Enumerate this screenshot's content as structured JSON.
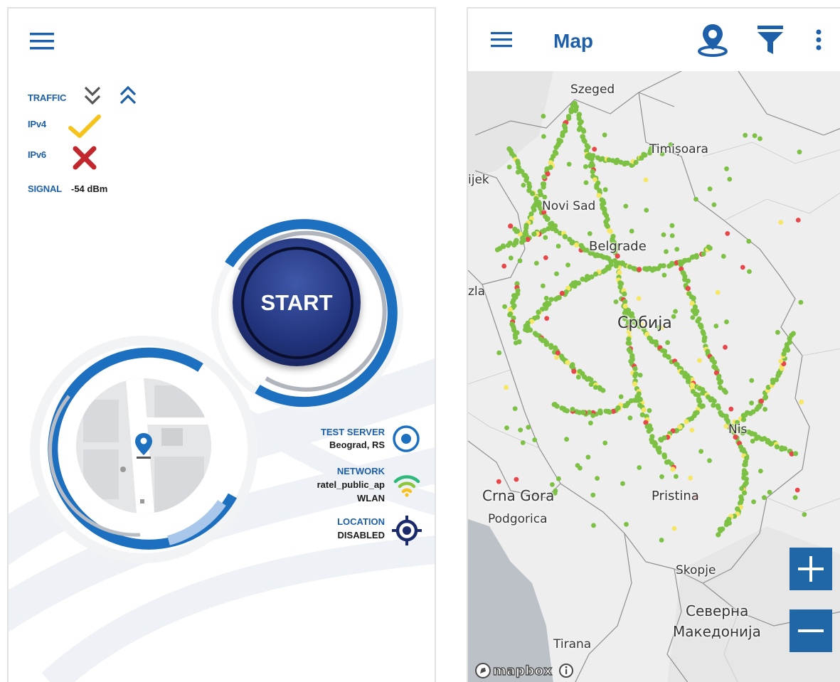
{
  "left": {
    "traffic_label": "TRAFFIC",
    "ipv4_label": "IPv4",
    "ipv6_label": "IPv6",
    "signal_label": "SIGNAL",
    "signal_value": "-54 dBm",
    "start_label": "START",
    "test_server_label": "TEST SERVER",
    "test_server_value": "Beograd, RS",
    "network_label": "NETWORK",
    "network_ssid": "ratel_public_ap",
    "network_type": "WLAN",
    "location_label": "LOCATION",
    "location_value": "DISABLED"
  },
  "right": {
    "title": "Map",
    "places": {
      "szeged": "Szeged",
      "timisoara": "Timișoara",
      "osijek": "ijek",
      "novi_sad": "Novi Sad",
      "belgrade": "Belgrade",
      "tuzla": "zla",
      "srbija": "Србија",
      "nis": "Nis",
      "crna_gora": "Crna Gora",
      "podgorica": "Podgorica",
      "pristina": "Pristina",
      "skopje": "Skopje",
      "severna": "Северна",
      "makedonija": "Македонија",
      "tirana": "Tirana"
    },
    "attribution": "mapbox"
  },
  "colors": {
    "brand_blue": "#1d5fa8",
    "dark_navy": "#1b2a6b",
    "check_yellow": "#f6c21c",
    "cross_red": "#c1272d",
    "dot_green": "#7cc143",
    "dot_yellow": "#f5e663",
    "dot_red": "#e8474a"
  }
}
